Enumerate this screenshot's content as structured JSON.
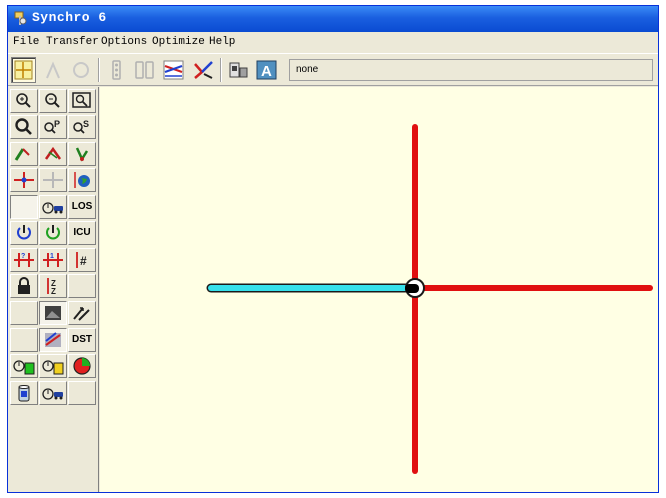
{
  "window": {
    "title": "Synchro 6",
    "title_icon": "synchro-app-icon"
  },
  "menu": [
    {
      "label": "File"
    },
    {
      "label": "Transfer"
    },
    {
      "label": "Options"
    },
    {
      "label": "Optimize"
    },
    {
      "label": "Help"
    }
  ],
  "toolbar": {
    "buttons": [
      "map-view-icon",
      "lanes-icon",
      "volumes-icon",
      "timing-icon",
      "phasing-icon",
      "simulation-icon",
      "detector-icon",
      "report-icon",
      "analysis-icon"
    ],
    "status_field": "none"
  },
  "left_panel": {
    "los_label": "LOS",
    "icu_label": "ICU",
    "dst_label": "DST"
  },
  "network": {
    "selected_link_color": "#36e0ea",
    "link_color": "#e01010",
    "node_color": "#000000"
  }
}
